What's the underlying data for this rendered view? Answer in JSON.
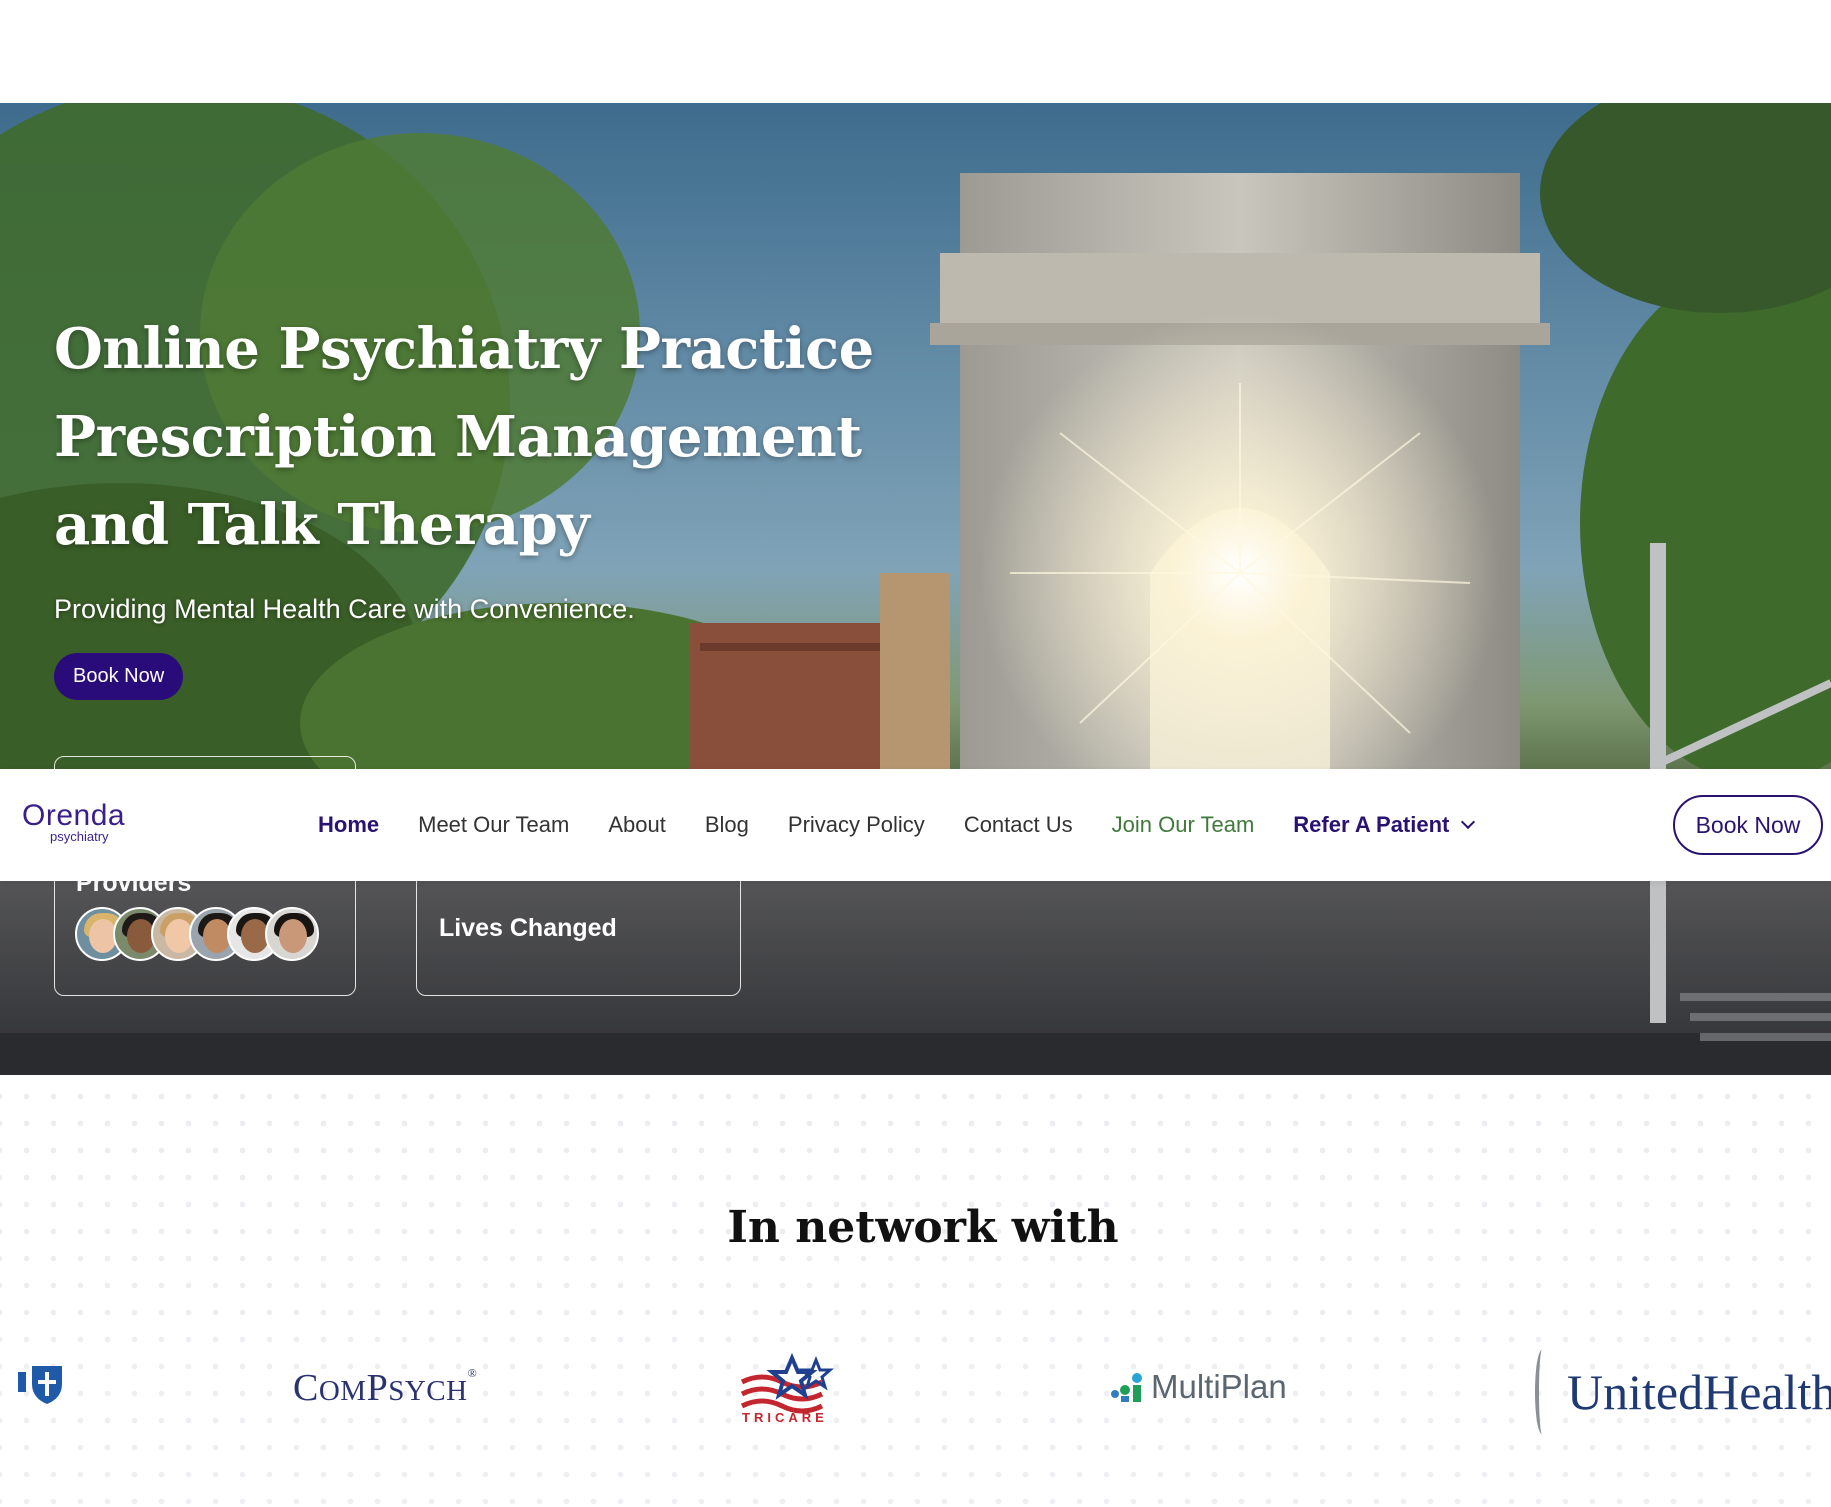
{
  "hero": {
    "title_lines": [
      "Online Psychiatry Practice",
      "Prescription Management",
      "and Talk Therapy"
    ],
    "subtitle": "Providing Mental Health Care with Convenience.",
    "cta_label": "Book Now",
    "providers_label": "Providers",
    "lives_label": "Lives Changed"
  },
  "nav": {
    "logo_main": "Orenda",
    "logo_sub": "psychiatry",
    "links": [
      "Home",
      "Meet Our Team",
      "About",
      "Blog",
      "Privacy Policy",
      "Contact Us",
      "Join Our Team",
      "Refer A Patient"
    ],
    "active": "Home",
    "book_label": "Book Now"
  },
  "network": {
    "title": "In network with",
    "logos": [
      {
        "name": "Blue Cross Blue Shield",
        "icon": "bcbs-logo"
      },
      {
        "name": "ComPsych",
        "text_main": "COMPSYCH"
      },
      {
        "name": "Tricare",
        "text": "TRICARE"
      },
      {
        "name": "MultiPlan",
        "text": "MultiPlan"
      },
      {
        "name": "UnitedHealthcare",
        "text": "UnitedHealthc"
      }
    ]
  },
  "colors": {
    "brand_purple": "#2a0b7a",
    "nav_text": "#333333",
    "join_green": "#3f7a3a"
  }
}
